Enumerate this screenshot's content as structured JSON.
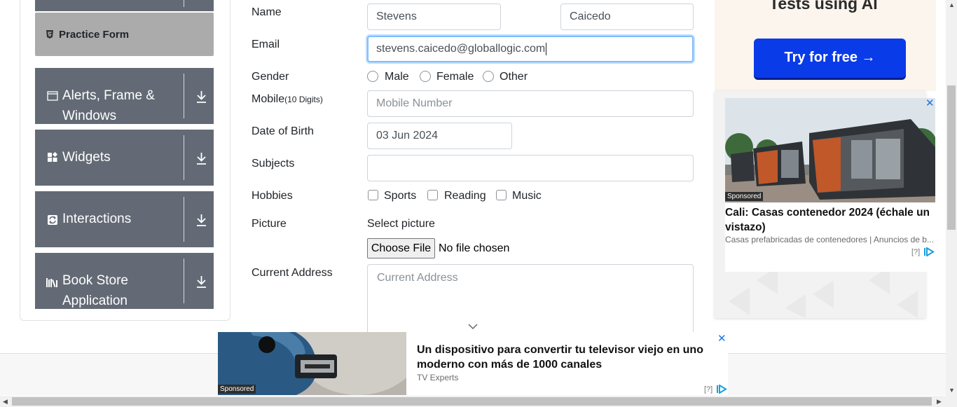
{
  "sidebar": {
    "active_item": "Practice Form",
    "groups": [
      {
        "title_line1": "Alerts, Frame &",
        "title_line2": "Windows",
        "icon": "window-icon"
      },
      {
        "title_line1": "Widgets",
        "title_line2": "",
        "icon": "widgets-icon"
      },
      {
        "title_line1": "Interactions",
        "title_line2": "",
        "icon": "interactions-icon"
      },
      {
        "title_line1": "Book Store",
        "title_line2": "Application",
        "icon": "books-icon"
      }
    ]
  },
  "form": {
    "name_label": "Name",
    "first_name": "Stevens",
    "last_name": "Caicedo",
    "email_label": "Email",
    "email_value": "stevens.caicedo@globallogic.com",
    "gender_label": "Gender",
    "gender_options": [
      "Male",
      "Female",
      "Other"
    ],
    "mobile_label": "Mobile",
    "mobile_hint": "(10 Digits)",
    "mobile_placeholder": "Mobile Number",
    "dob_label": "Date of Birth",
    "dob_value": "03 Jun 2024",
    "subjects_label": "Subjects",
    "hobbies_label": "Hobbies",
    "hobbies_options": [
      "Sports",
      "Reading",
      "Music"
    ],
    "picture_label": "Picture",
    "picture_select_label": "Select picture",
    "choose_file_button": "Choose File",
    "no_file_text": "No file chosen",
    "address_label": "Current Address",
    "address_placeholder": "Current Address"
  },
  "right_ad": {
    "top_heading": "Tests using AI",
    "try_button": "Try for free →",
    "sponsored": "Sponsored",
    "title": "Cali: Casas contenedor 2024 (échale un vistazo)",
    "source": "Casas prefabricadas de contenedores | Anuncios de b...",
    "info": "[?]"
  },
  "bottom_ad": {
    "sponsored": "Sponsored",
    "title": "Un dispositivo para convertir tu televisor viejo en uno moderno con más de 1000 canales",
    "source": "TV Experts",
    "info": "[?]"
  },
  "colors": {
    "sidebar_group": "#636a75",
    "sidebar_active": "#ababab",
    "focus_border": "#80bdff",
    "ad_button": "#0a3be8"
  }
}
